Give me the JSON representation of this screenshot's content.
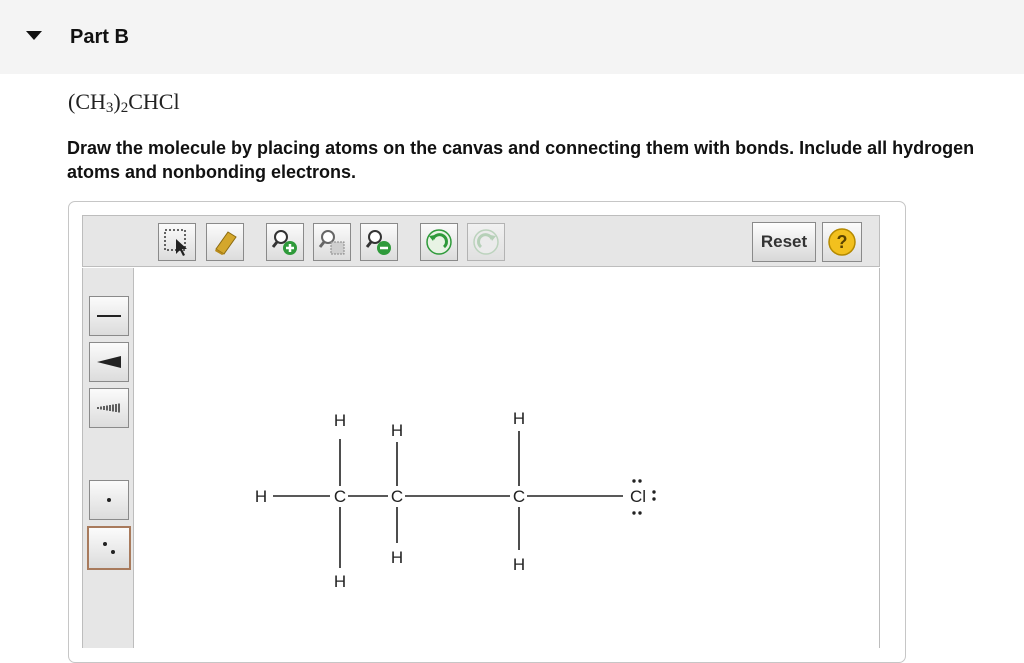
{
  "part": {
    "title": "Part B"
  },
  "formula": {
    "prefix": "(CH",
    "sub1": "3",
    "mid": ")",
    "sub2": "2",
    "suffix": "CHCl"
  },
  "instructions": "Draw the molecule by placing atoms on the canvas and connecting them with bonds. Include all hydrogen atoms and nonbonding electrons.",
  "toolbar": {
    "reset_label": "Reset",
    "help_label": "?",
    "tools": [
      {
        "name": "select-tool",
        "icon": "marquee-select-icon"
      },
      {
        "name": "eraser-tool",
        "icon": "eraser-icon"
      },
      {
        "name": "add-charge-tool",
        "icon": "zoom-plus-icon"
      },
      {
        "name": "template-tool",
        "icon": "zoom-template-icon"
      },
      {
        "name": "remove-charge-tool",
        "icon": "zoom-minus-icon"
      },
      {
        "name": "undo-tool",
        "icon": "undo-icon"
      },
      {
        "name": "redo-tool",
        "icon": "redo-icon",
        "disabled": true
      }
    ],
    "side_tools": [
      {
        "name": "single-bond-tool",
        "icon": "single-bond-icon"
      },
      {
        "name": "wedge-bond-tool",
        "icon": "wedge-bond-icon"
      },
      {
        "name": "hash-bond-tool",
        "icon": "hash-bond-icon"
      },
      {
        "name": "radical-tool",
        "icon": "single-dot-icon"
      },
      {
        "name": "lone-pair-tool",
        "icon": "lone-pair-icon",
        "selected": true
      }
    ]
  },
  "molecule": {
    "atoms": [
      "H",
      "C",
      "C",
      "C",
      "Cl",
      "H",
      "H",
      "H",
      "H",
      "H",
      "H"
    ]
  },
  "colors": {
    "accent": "#a87a5c",
    "green": "#2e9a3a",
    "panel": "#e6e6e6"
  }
}
